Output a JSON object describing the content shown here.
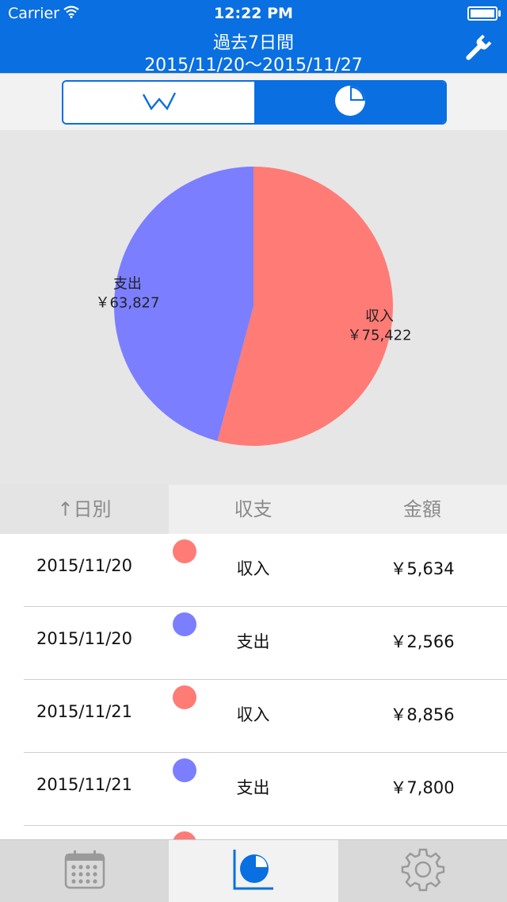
{
  "status_bar": {
    "carrier": "Carrier",
    "time": "12:22 PM"
  },
  "nav": {
    "title": "過去7日間",
    "subtitle": "2015/11/20～2015/11/27",
    "settings_icon": "wrench-icon"
  },
  "segmented_control": {
    "options": [
      {
        "icon": "line-chart-icon",
        "selected": false
      },
      {
        "icon": "pie-chart-icon",
        "selected": true
      }
    ]
  },
  "chart_data": {
    "type": "pie",
    "slices": [
      {
        "label": "収入",
        "value_label": "￥75,422",
        "value": 75422,
        "color": "#ff7b76"
      },
      {
        "label": "支出",
        "value_label": "￥63,827",
        "value": 63827,
        "color": "#7b7eff"
      }
    ]
  },
  "table_header": {
    "sort_col": "↑日別",
    "type_col": "収支",
    "amount_col": "金額"
  },
  "rows": [
    {
      "date": "2015/11/20",
      "type": "収入",
      "amount": "￥5,634",
      "color": "#ff7b76"
    },
    {
      "date": "2015/11/20",
      "type": "支出",
      "amount": "￥2,566",
      "color": "#7b7eff"
    },
    {
      "date": "2015/11/21",
      "type": "収入",
      "amount": "￥8,856",
      "color": "#ff7b76"
    },
    {
      "date": "2015/11/21",
      "type": "支出",
      "amount": "￥7,800",
      "color": "#7b7eff"
    }
  ],
  "tabbar": {
    "tabs": [
      {
        "icon": "calendar-icon",
        "selected": false
      },
      {
        "icon": "report-chart-icon",
        "selected": true
      },
      {
        "icon": "gear-icon",
        "selected": false
      }
    ]
  },
  "colors": {
    "accent": "#0a6fe0",
    "income": "#ff7b76",
    "expense": "#7b7eff"
  }
}
